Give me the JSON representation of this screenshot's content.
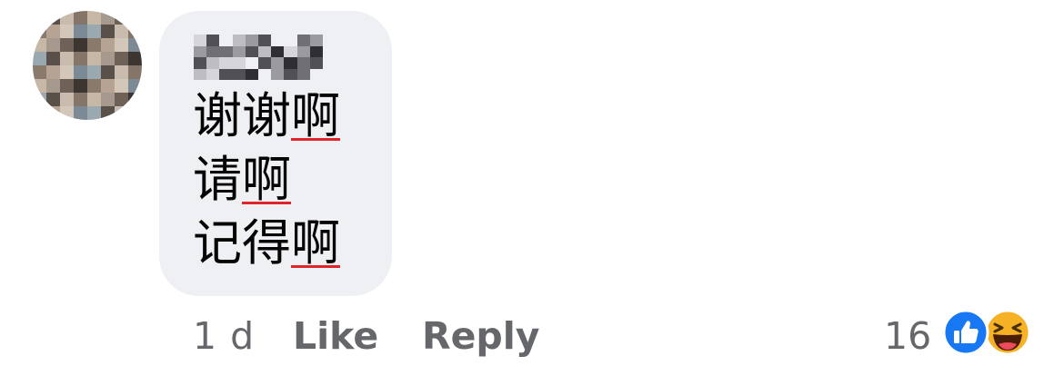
{
  "comment": {
    "lines": [
      {
        "text": "谢谢",
        "flagged": "啊"
      },
      {
        "text": "请",
        "flagged": "啊"
      },
      {
        "text": "记得",
        "flagged": "啊"
      }
    ]
  },
  "actions": {
    "time": "1 d",
    "like_label": "Like",
    "reply_label": "Reply"
  },
  "reactions": {
    "count": "16",
    "types": [
      "like-icon",
      "haha-icon"
    ],
    "colors": {
      "like": "#1877f2",
      "haha": "#f7b125"
    }
  },
  "colors": {
    "bubble": "#eff0f4",
    "meta_text": "#65676b",
    "spellcheck": "#e0242c"
  }
}
